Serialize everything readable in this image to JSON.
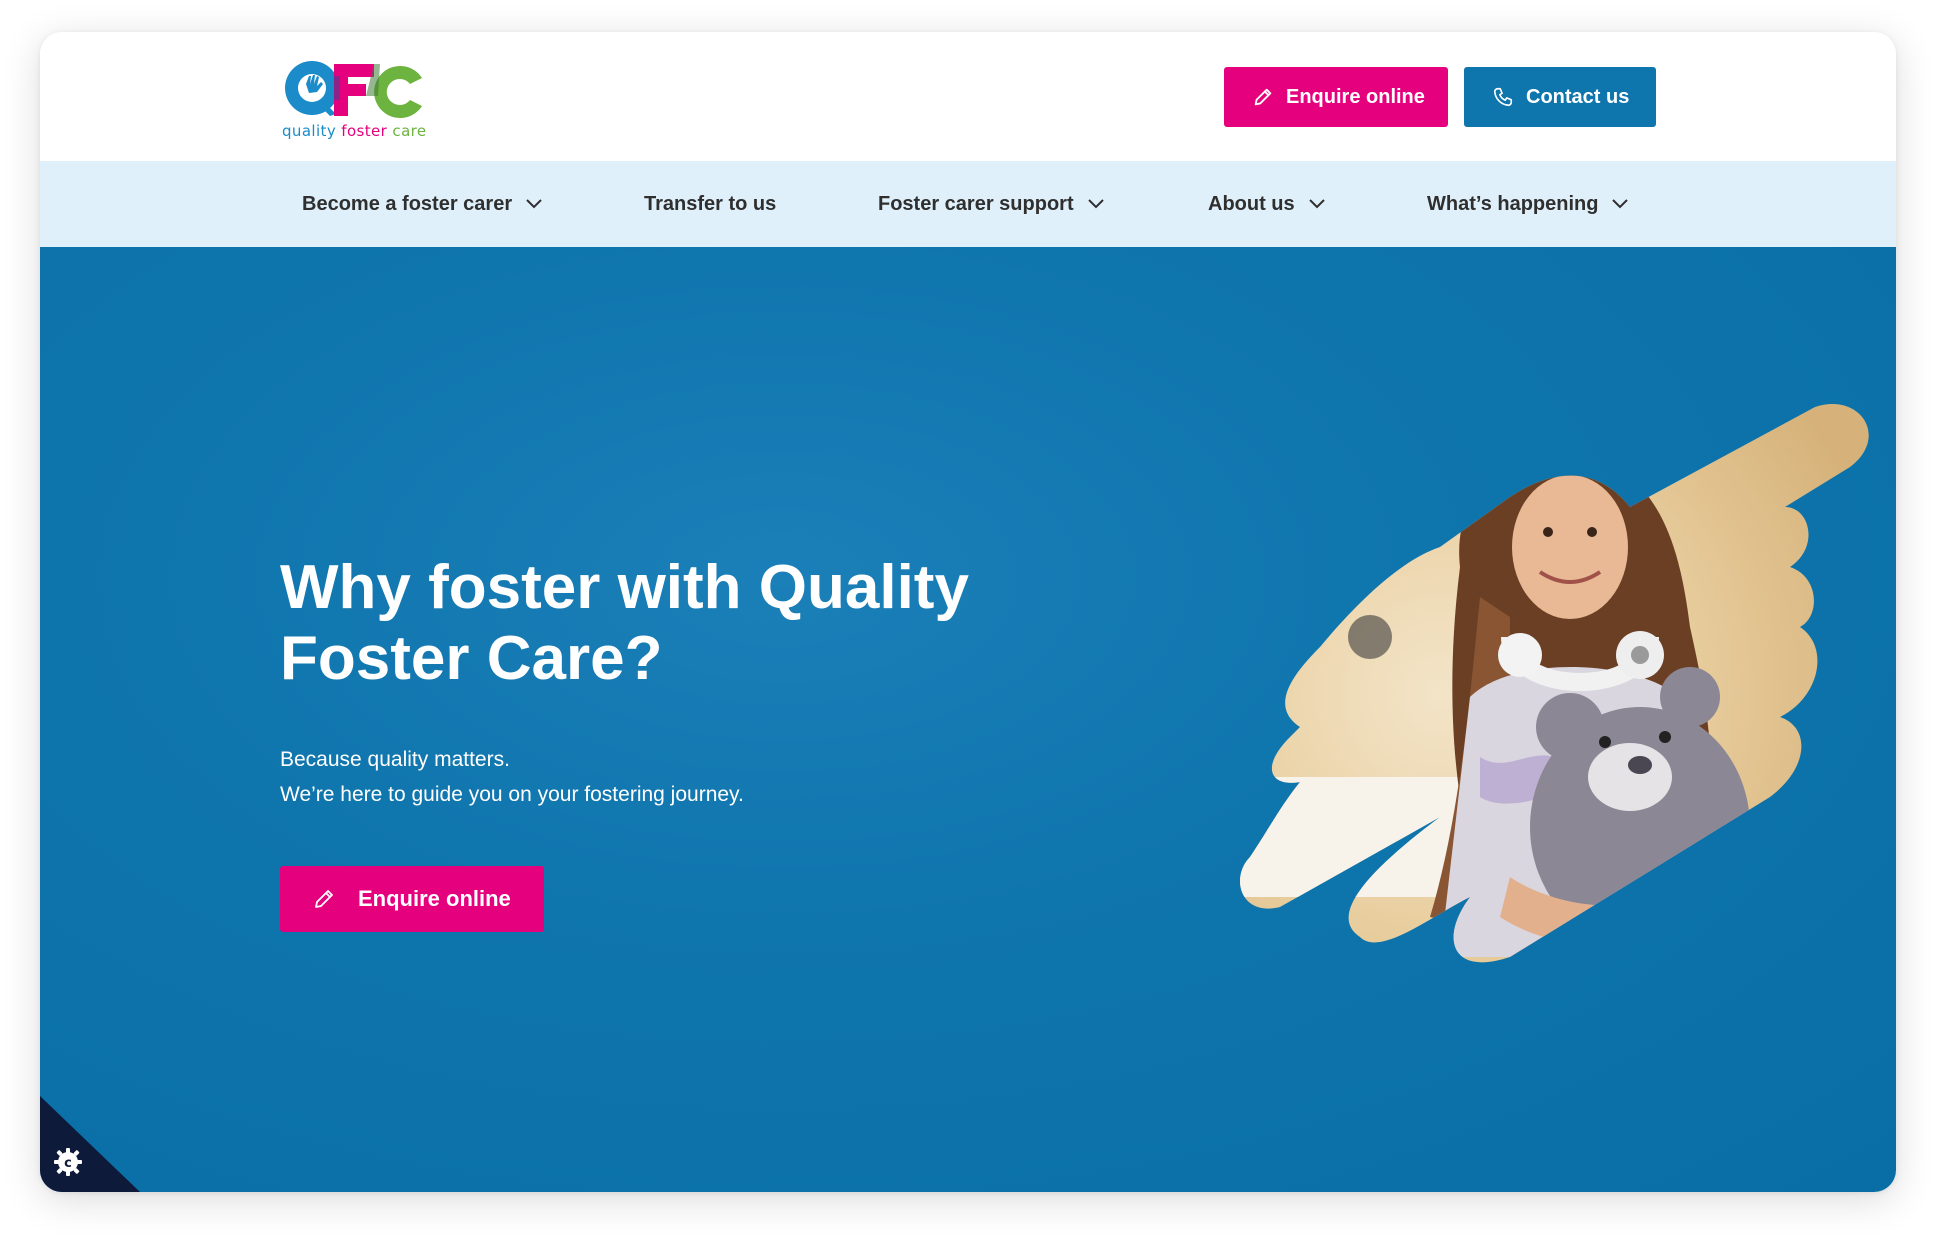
{
  "header": {
    "logo": {
      "letters": "QFC",
      "word1": "quality",
      "word2": "foster",
      "word3": "care"
    },
    "enquire_label": "Enquire online",
    "contact_label": "Contact us"
  },
  "nav": {
    "items": [
      {
        "label": "Become a foster carer",
        "has_dropdown": true
      },
      {
        "label": "Transfer to us",
        "has_dropdown": false
      },
      {
        "label": "Foster carer support",
        "has_dropdown": true
      },
      {
        "label": "About us",
        "has_dropdown": true
      },
      {
        "label": "What’s happening",
        "has_dropdown": true
      }
    ]
  },
  "hero": {
    "title": "Why foster with Quality Foster Care?",
    "subtitle_line1": "Because quality matters.",
    "subtitle_line2": "We’re here to guide you on your fostering journey.",
    "cta_label": "Enquire online",
    "image_subject": "girl holding teddy bear wearing headphones"
  },
  "icons": {
    "enquire": "pencil-icon",
    "contact": "phone-icon",
    "dropdown": "chevron-down-icon",
    "cookie": "gear-icon"
  },
  "colors": {
    "brand_pink": "#e5007e",
    "brand_blue": "#0f75ad",
    "nav_bg": "#dff0fb",
    "logo_blue": "#1b8bc9",
    "logo_green": "#6cb33f"
  }
}
